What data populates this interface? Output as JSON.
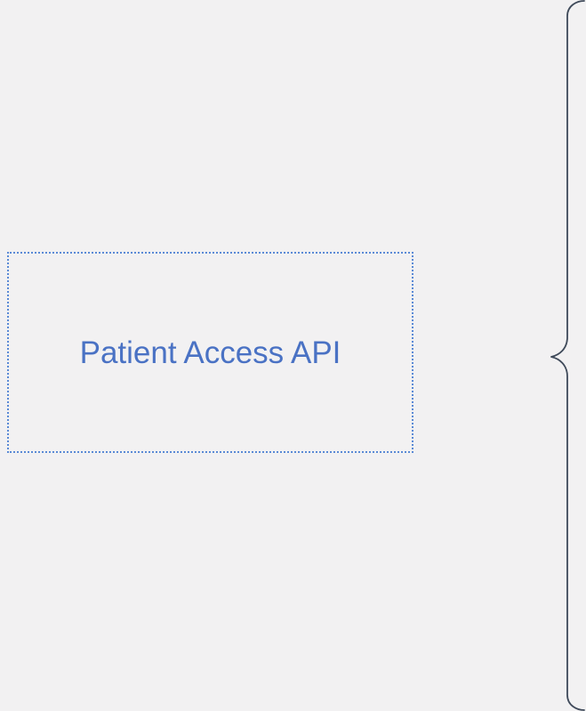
{
  "diagram": {
    "background_color": "#f2f1f2",
    "accent_color": "#4a72c4",
    "box_border_color": "#5b8ad6",
    "brace_color": "#3f4a5a",
    "api_box": {
      "label": "Patient Access API"
    },
    "brace_icon": "right-curly-brace-icon"
  }
}
